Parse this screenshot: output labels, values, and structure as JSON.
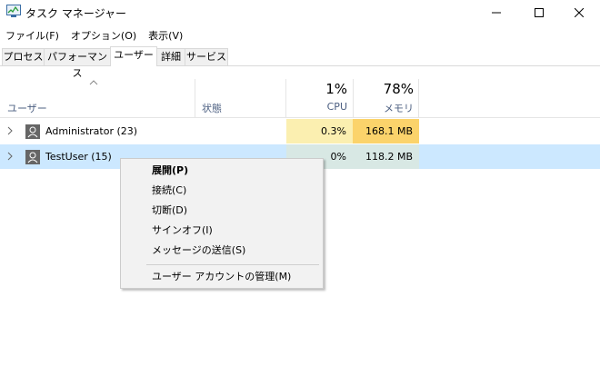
{
  "window": {
    "title": "タスク マネージャー"
  },
  "menubar": {
    "items": [
      "ファイル(F)",
      "オプション(O)",
      "表示(V)"
    ]
  },
  "tabs": [
    "プロセス",
    "パフォーマンス",
    "ユーザー",
    "詳細",
    "サービス"
  ],
  "active_tab": "ユーザー",
  "columns": {
    "user": "ユーザー",
    "status": "状態",
    "cpu_percent": "1%",
    "cpu_label": "CPU",
    "memory_percent": "78%",
    "memory_label": "メモリ"
  },
  "rows": [
    {
      "name": "Administrator (23)",
      "cpu": "0.3%",
      "memory": "168.1 MB",
      "cpu_color": "#fbefb0",
      "mem_color": "#fbd36b"
    },
    {
      "name": "TestUser (15)",
      "cpu": "0%",
      "memory": "118.2 MB",
      "cpu_color": "#d8e8e4",
      "mem_color": "#d8e8e4"
    }
  ],
  "selected_row": "TestUser (15)",
  "context_menu": {
    "items": [
      {
        "label": "展開(P)",
        "bold": true
      },
      {
        "label": "接続(C)"
      },
      {
        "label": "切断(D)"
      },
      {
        "label": "サインオフ(I)"
      },
      {
        "label": "メッセージの送信(S)"
      },
      {
        "label": "ユーザー アカウントの管理(M)"
      }
    ]
  },
  "colors": {
    "accent_header": "#4d6082",
    "selection": "#cce8ff",
    "menu_bg": "#f2f2f2"
  }
}
